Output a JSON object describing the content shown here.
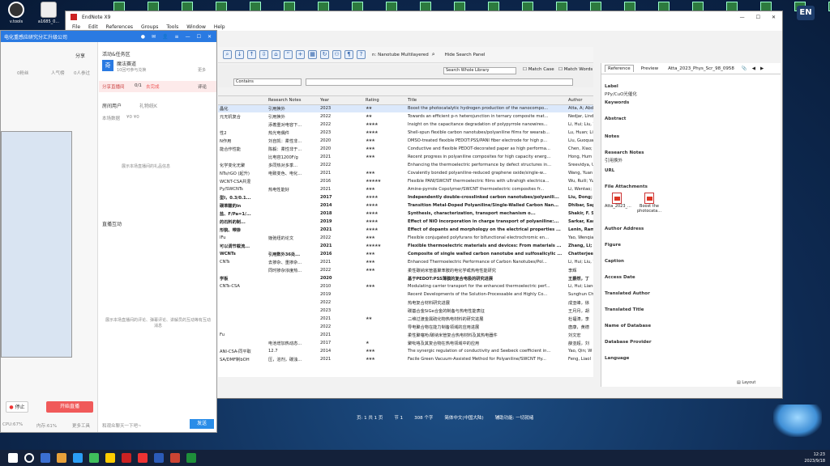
{
  "desktop": {
    "icons": [
      {
        "label": "v.tools"
      },
      {
        "label": "a1685_0..."
      }
    ],
    "lang_badge": "EN"
  },
  "endnote": {
    "title": "EndNote X9",
    "menu": [
      "File",
      "Edit",
      "References",
      "Groups",
      "Tools",
      "Window",
      "Help"
    ],
    "search_text": "n: Nanotube Multilayered",
    "hide_search": "Hide Search Panel",
    "search_scope": "Search Whole Library",
    "match_case": "Match Case",
    "match_words": "Match Words",
    "operator": "Contains",
    "columns": [
      "Research Notes",
      "Year",
      "Rating",
      "Title",
      "Author"
    ],
    "rows": [
      {
        "left": "晶化",
        "notes": "引用换外",
        "year": "2023",
        "rating": "★★",
        "title": "Boost the photocatalytic hydrogen production of the nanocompo...",
        "author": "Atta, A; Abd",
        "bold": false
      },
      {
        "left": "元无机复合",
        "notes": "引用换外",
        "year": "2022",
        "rating": "★★",
        "title": "Towards an efficient p-n heterojunction in ternary composite mat...",
        "author": "Nedjar, Lind",
        "bold": false
      },
      {
        "left": "",
        "notes": "添着重对电容下...",
        "year": "2022",
        "rating": "★★★★",
        "title": "Insight on the capacitance degradation of polypyrrole nanowires...",
        "author": "Li, Hui; Liu, Y",
        "bold": false
      },
      {
        "left": "性2",
        "notes": "热光电偶件",
        "year": "2023",
        "rating": "★★★★",
        "title": "Shell-spun flexible carbon nanotubes/polyaniline films for wearab...",
        "author": "Lu, Huan; Li",
        "bold": false
      },
      {
        "left": "N作用",
        "notes": "刘自凯：柔性非...",
        "year": "2020",
        "rating": "★★★",
        "title": "DMSO-treated flexible PEDOT:PSS/PANI fiber electrode for high p...",
        "author": "Liu, Guoquan",
        "bold": false
      },
      {
        "left": "能合作性能",
        "notes": "陈毅：柔性非于...",
        "year": "2020",
        "rating": "★★★",
        "title": "Conductive and flexible PEDOT-decorated paper as high performa...",
        "author": "Chen, Xiao; L",
        "bold": false
      },
      {
        "left": "",
        "notes": "比电容1200F/g",
        "year": "2021",
        "rating": "★★★",
        "title": "Recent progress in polyaniline composites for high capacity energ...",
        "author": "Hong, Hum",
        "bold": false
      },
      {
        "left": "化学变化无聚",
        "notes": "多同热对多季...",
        "year": "2022",
        "rating": "",
        "title": "Enhancing the thermoelectric performance by defect structures in...",
        "author": "Sreevidya, U",
        "bold": false
      },
      {
        "left": "NTs/rGO (起升)",
        "notes": "电致变色、电化...",
        "year": "2021",
        "rating": "★★★",
        "title": "Covalently bonded polyaniline-reduced graphene oxide/single-w...",
        "author": "Wang, Yuan",
        "bold": false
      },
      {
        "left": "WCNT-CSA共混",
        "notes": "",
        "year": "2016",
        "rating": "★★★★★",
        "title": "Flexible PANI/SWCNT thermoelectric films with ultrahigh electrica...",
        "author": "Wu, Ruili; Yu",
        "bold": false
      },
      {
        "left": "Py/SWCNTs",
        "notes": "热电性能好",
        "year": "2021",
        "rating": "★★★",
        "title": "Amine-pyrrole Copolymer/SWCNT thermoelectric composites fr...",
        "author": "Li, Wentao;",
        "bold": false
      },
      {
        "left": "型Ⅰ，0.3/0.1...",
        "notes": "",
        "year": "2017",
        "rating": "★★★★",
        "title": "Independently double-crosslinked carbon nanotubes/polyanili...",
        "author": "Liu, Dong; W",
        "bold": true
      },
      {
        "left": "碳苯酸的in",
        "notes": "",
        "year": "2014",
        "rating": "★★★★",
        "title": "Transition Metal-Doped Polyaniline/Single-Walled Carbon Nan...",
        "author": "Dhibar, Sapt",
        "bold": true
      },
      {
        "left": "盐、F/Pa=1/...",
        "notes": "",
        "year": "2018",
        "rating": "★★★★",
        "title": "Synthesis, characterization, transport mechanism o...",
        "author": "Shakir, F. S.;",
        "bold": true
      },
      {
        "left": "的石料的制...",
        "notes": "",
        "year": "2019",
        "rating": "★★★★",
        "title": "Effect of NiO incorporation in charge transport of polyaniline:...",
        "author": "Sarkar, Kam",
        "bold": true
      },
      {
        "left": "形貌、带掺",
        "notes": "",
        "year": "2021",
        "rating": "★★★★",
        "title": "Effect of dopants and morphology on the electrical properties ...",
        "author": "Lenin, Rama",
        "bold": true
      },
      {
        "left": "IFu",
        "notes": "娩弛纽的论文",
        "year": "2022",
        "rating": "★★★",
        "title": "Flexible conjugated polyfurans for bifunctional electrochromic en...",
        "author": "Yao, Wenqia",
        "bold": false
      },
      {
        "left": "可以调节载流...",
        "notes": "",
        "year": "2021",
        "rating": "★★★★★",
        "title": "Flexible thermoelectric materials and devices: From materials ...",
        "author": "Zhang, Li; Sh",
        "bold": true
      },
      {
        "left": "WCNTs",
        "notes": "引用数外36处...",
        "year": "2016",
        "rating": "★★★",
        "title": "Composite of single walled carbon nanotube and sulfosalicylic ...",
        "author": "Chatterjee,",
        "bold": true
      },
      {
        "left": "CNTs",
        "notes": "去掺杂、重掺杂...",
        "year": "2021",
        "rating": "★★★",
        "title": "Enhanced Thermoelectric Performance of Carbon Nanotubes/Pol...",
        "author": "Li, Hui; Liu, Y",
        "bold": false
      },
      {
        "left": "",
        "notes": "同时掺杂浓度热...",
        "year": "2022",
        "rating": "★★★",
        "title": "柔性碳纳米管基聚苯胺的电化学或热电性能研究",
        "author": "李辉",
        "bold": false
      },
      {
        "left": "学板",
        "notes": "",
        "year": "2020",
        "rating": "",
        "title": "基于PEDOT:PSS薄膜的复合电极的研究进展",
        "author": "王爵然，丁",
        "bold": true
      },
      {
        "left": "CNTs-CSA",
        "notes": "",
        "year": "2010",
        "rating": "★★★",
        "title": "Modulating carrier transport for the enhanced thermoelectric perf...",
        "author": "Li, Hui; Liang",
        "bold": false
      },
      {
        "left": "",
        "notes": "",
        "year": "2019",
        "rating": "",
        "title": "Recent Developments of the Solution-Processable and Highly Co...",
        "author": "Sunghun Ch",
        "bold": false
      },
      {
        "left": "",
        "notes": "",
        "year": "2022",
        "rating": "",
        "title": "热电复合材料研究进展",
        "author": "成亚峰，徐",
        "bold": false
      },
      {
        "left": "",
        "notes": "",
        "year": "2023",
        "rating": "",
        "title": "碳基合金SiGe合金的制备与热电性能表征",
        "author": "王月月，胡",
        "bold": false
      },
      {
        "left": "",
        "notes": "",
        "year": "2021",
        "rating": "★★",
        "title": "二维过渡金属硫化物热电材料的研究进展",
        "author": "杜福涛，李",
        "bold": false
      },
      {
        "left": "",
        "notes": "",
        "year": "2022",
        "rating": "",
        "title": "导电聚合物在能力制备领域的应用进展",
        "author": "唐康，黄德",
        "bold": false
      },
      {
        "left": "Fu",
        "notes": "",
        "year": "2021",
        "rating": "",
        "title": "柔性聚噻吩/碳纳米管复合热电材料及其热电器件",
        "author": "刘文宏",
        "bold": false
      },
      {
        "left": "",
        "notes": "电池增加热动态...",
        "year": "2017",
        "rating": "★",
        "title": "聚吡咯及其复合物在热电领域中的应用",
        "author": "薛亚超，刘",
        "bold": false
      },
      {
        "left": "ANI-CSA-同平取",
        "notes": "12.7",
        "year": "2014",
        "rating": "★★★",
        "title": "The synergic regulation of conductivity and Seebeck coefficient in...",
        "author": "Yao, Qin; W",
        "bold": false
      },
      {
        "left": "SA/DMF制bOH",
        "notes": "压，溶剂，碳浊...",
        "year": "2021",
        "rating": "★★★",
        "title": "Facile Green Vacuum-Assisted Method for Polyaniline/SWCNT Hy...",
        "author": "Feng, Liaol",
        "bold": false
      }
    ],
    "panel": {
      "tabs": [
        "Reference",
        "Preview"
      ],
      "attach_tab": "Atta_2023_Phys_Scr_98_0958",
      "fields": {
        "label": "Label",
        "label_value": "PPy/CuO光催化",
        "keywords": "Keywords",
        "abstract": "Abstract",
        "notes": "Notes",
        "research_notes": "Research Notes",
        "research_notes_value": "引用换外",
        "url": "URL",
        "file_attachments": "File Attachments",
        "author_address": "Author Address",
        "figure": "Figure",
        "caption": "Caption",
        "access_date": "Access Date",
        "translated_author": "Translated Author",
        "translated_title": "Translated Title",
        "name_of_database": "Name of Database",
        "database_provider": "Database Provider",
        "language": "Language"
      },
      "attachments": [
        {
          "name": "Atta_2023_..."
        },
        {
          "name": "Boost the photocata..."
        }
      ]
    },
    "layout_label": "Layout",
    "status": [
      "页: 1 共 1 页",
      "节 1",
      "308 个字",
      "简体中文(中国大陆)",
      "辅助功能: 一切就绪"
    ]
  },
  "chat": {
    "title": "电化重感应研究分汇升级公司",
    "share": "分享",
    "stats": [
      "0粉丝",
      "人气榜",
      "0人参过"
    ],
    "activity_title": "活动&任务区",
    "activity_name": "魔法赛道",
    "activity_sub": "10回可参与兑换",
    "more": "更多",
    "share_live": "分享直播间",
    "share_count": "0/1",
    "share_note": "去完成",
    "review_label": "评论",
    "user_label": "房间用户",
    "user_tag": "礼物统K",
    "room_data": "本场数据",
    "room_vals": "¥0  ¥0",
    "empty_gifts": "展示本场直播间的礼品信息",
    "interaction": "直播互动",
    "empty_interaction": "展示本场直播间的评论、弹幕评论、讲解员的互动等有互动消息",
    "stop": "停止",
    "start_live": "开始直播",
    "cpu": "CPU:67%",
    "mem": "内存:61%",
    "more_tools": "更多工具",
    "input_placeholder": "和观众聊天一下吧~",
    "send": "发送"
  },
  "tray": {
    "time": "12:23",
    "date": "2023/9/18"
  }
}
